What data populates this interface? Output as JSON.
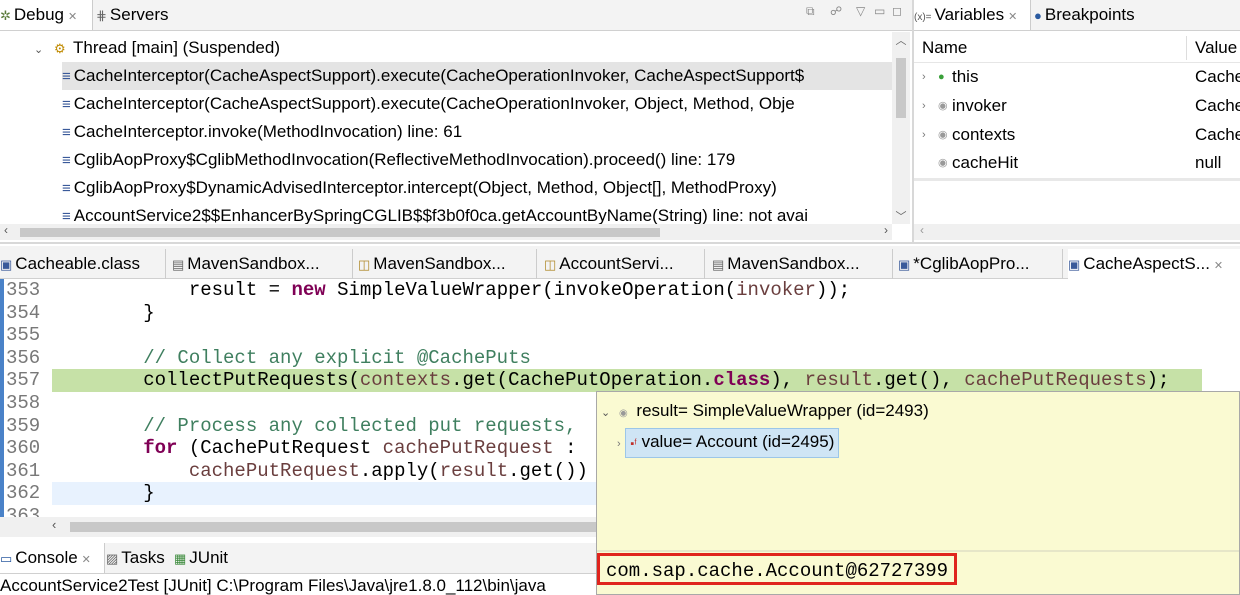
{
  "debug_view": {
    "tabs": [
      {
        "label": "Debug",
        "icon": "debug-icon"
      },
      {
        "label": "Servers",
        "icon": "servers-icon"
      }
    ],
    "thread": "Thread [main] (Suspended)",
    "frames": [
      "CacheInterceptor(CacheAspectSupport).execute(CacheOperationInvoker, CacheAspectSupport$",
      "CacheInterceptor(CacheAspectSupport).execute(CacheOperationInvoker, Object, Method, Obje",
      "CacheInterceptor.invoke(MethodInvocation) line: 61",
      "CglibAopProxy$CglibMethodInvocation(ReflectiveMethodInvocation).proceed() line: 179",
      "CglibAopProxy$DynamicAdvisedInterceptor.intercept(Object, Method, Object[], MethodProxy)",
      "AccountService2$$EnhancerBySpringCGLIB$$f3b0f0ca.getAccountByName(String) line: not avai"
    ]
  },
  "variables_view": {
    "tabs": [
      {
        "label": "Variables",
        "icon": "variables-icon"
      },
      {
        "label": "Breakpoints",
        "icon": "breakpoints-icon"
      }
    ],
    "columns": [
      "Name",
      "Value"
    ],
    "rows": [
      {
        "name": "this",
        "value": "Cache"
      },
      {
        "name": "invoker",
        "value": "Cache"
      },
      {
        "name": "contexts",
        "value": "Cache"
      },
      {
        "name": "cacheHit",
        "value": "null"
      }
    ]
  },
  "editor": {
    "tabs": [
      "Cacheable.class",
      "MavenSandbox...",
      "MavenSandbox...",
      "AccountServi...",
      "MavenSandbox...",
      "*CglibAopPro...",
      "CacheAspectS..."
    ],
    "line_numbers": [
      "353",
      "354",
      "355",
      "356",
      "357",
      "358",
      "359",
      "360",
      "361",
      "362",
      "363"
    ],
    "code": {
      "l353_indent": "            result = ",
      "l353_kw": "new",
      "l353_rest": " SimpleValueWrapper(invokeOperation(",
      "l353_var": "invoker",
      "l353_end": "));",
      "l354": "        }",
      "l356": "        // Collect any explicit @CachePuts",
      "l357_a": "        collectPutRequests(",
      "l357_var1": "contexts",
      "l357_b": ".get(CachePutOperation.",
      "l357_kw": "class",
      "l357_c": "), ",
      "l357_var2": "result",
      "l357_d": ".get(), ",
      "l357_var3": "cachePutRequests",
      "l357_e": ");",
      "l359": "        // Process any collected put requests,",
      "l360_kw": "for",
      "l360_a": " (CachePutRequest ",
      "l360_var": "cachePutRequest",
      "l360_b": " :",
      "l361_var1": "cachePutRequest",
      "l361_a": ".apply(",
      "l361_var2": "result",
      "l361_b": ".get())",
      "l362": "        }"
    }
  },
  "inspect_popup": {
    "root": "result= SimpleValueWrapper  (id=2493)",
    "child": "value= Account  (id=2495)",
    "detail": "com.sap.cache.Account@62727399"
  },
  "bottom_view": {
    "tabs": [
      {
        "label": "Console",
        "icon": "console-icon"
      },
      {
        "label": "Tasks",
        "icon": "tasks-icon"
      },
      {
        "label": "JUnit",
        "icon": "junit-icon"
      }
    ],
    "console_line": "AccountService2Test [JUnit] C:\\Program Files\\Java\\jre1.8.0_112\\bin\\java"
  }
}
